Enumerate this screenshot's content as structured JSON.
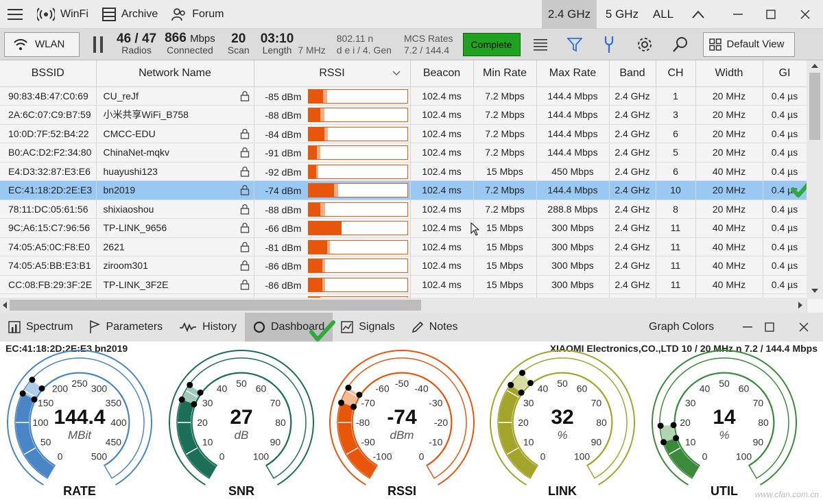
{
  "topbar": {
    "tabs": [
      {
        "label": "WinFi",
        "icon": "wifi-signal-icon"
      },
      {
        "label": "Archive",
        "icon": "archive-icon"
      },
      {
        "label": "Forum",
        "icon": "people-icon"
      }
    ],
    "bands": [
      "2.4 GHz",
      "5 GHz",
      "ALL"
    ],
    "selected_band": "2.4 GHz"
  },
  "toolbar": {
    "wlan_label": "WLAN",
    "radios_value": "46 / 47",
    "radios_label": "Radios",
    "connected_value": "866",
    "connected_unit": "Mbps",
    "connected_label": "Connected",
    "scan_value": "20",
    "scan_label": "Scan",
    "length_value": "03:10",
    "length_label": "Length",
    "freq_partial": "7 MHz",
    "std_line1": "802.11 n",
    "std_line2": "d e i / 4. Gen",
    "mcs_line1": "MCS Rates",
    "mcs_line2": "7.2 / 144.4",
    "complete_label": "Complete",
    "default_view_label": "Default View"
  },
  "table": {
    "columns": [
      "BSSID",
      "Network Name",
      "RSSI",
      "Beacon",
      "Min Rate",
      "Max Rate",
      "Band",
      "CH",
      "Width",
      "GI"
    ],
    "rows": [
      {
        "bssid": "90:83:4B:47:C0:69",
        "name": "CU_reJf",
        "locked": true,
        "rssi": "-85 dBm",
        "rssi_level": 0.15,
        "rssi_peak": 0.19,
        "beacon": "102.4 ms",
        "min": "7.2 Mbps",
        "max": "144.4 Mbps",
        "band": "2.4 GHz",
        "ch": "1",
        "width": "20 MHz",
        "gi": "0.4 µs"
      },
      {
        "bssid": "2A:6C:07:C9:B7:59",
        "name": "小米共享WiFi_B758",
        "locked": false,
        "rssi": "-88 dBm",
        "rssi_level": 0.12,
        "rssi_peak": 0.16,
        "beacon": "102.4 ms",
        "min": "7.2 Mbps",
        "max": "144.4 Mbps",
        "band": "2.4 GHz",
        "ch": "3",
        "width": "20 MHz",
        "gi": "0.4 µs"
      },
      {
        "bssid": "10:0D:7F:52:B4:22",
        "name": "CMCC-EDU",
        "locked": true,
        "rssi": "-84 dBm",
        "rssi_level": 0.16,
        "rssi_peak": 0.2,
        "beacon": "102.4 ms",
        "min": "7.2 Mbps",
        "max": "144.4 Mbps",
        "band": "2.4 GHz",
        "ch": "6",
        "width": "20 MHz",
        "gi": "0.4 µs"
      },
      {
        "bssid": "B0:AC:D2:F2:34:80",
        "name": "ChinaNet-mqkv",
        "locked": true,
        "rssi": "-91 dBm",
        "rssi_level": 0.09,
        "rssi_peak": 0.12,
        "beacon": "102.4 ms",
        "min": "7.2 Mbps",
        "max": "144.4 Mbps",
        "band": "2.4 GHz",
        "ch": "5",
        "width": "20 MHz",
        "gi": "0.4 µs"
      },
      {
        "bssid": "E4:D3:32:87:E3:E6",
        "name": "huayushi123",
        "locked": true,
        "rssi": "-92 dBm",
        "rssi_level": 0.08,
        "rssi_peak": 0.1,
        "beacon": "102.4 ms",
        "min": "15 Mbps",
        "max": "450 Mbps",
        "band": "2.4 GHz",
        "ch": "6",
        "width": "40 MHz",
        "gi": "0.4 µs"
      },
      {
        "bssid": "EC:41:18:2D:2E:E3",
        "name": "bn2019",
        "locked": true,
        "rssi": "-74 dBm",
        "rssi_level": 0.26,
        "rssi_peak": 0.3,
        "beacon": "102.4 ms",
        "min": "7.2 Mbps",
        "max": "144.4 Mbps",
        "band": "2.4 GHz",
        "ch": "10",
        "width": "20 MHz",
        "gi": "0.4 µs",
        "selected": true
      },
      {
        "bssid": "78:11:DC:05:61:56",
        "name": "shixiaoshou",
        "locked": true,
        "rssi": "-88 dBm",
        "rssi_level": 0.12,
        "rssi_peak": 0.17,
        "beacon": "102.4 ms",
        "min": "7.2 Mbps",
        "max": "288.8 Mbps",
        "band": "2.4 GHz",
        "ch": "8",
        "width": "20 MHz",
        "gi": "0.4 µs"
      },
      {
        "bssid": "9C:A6:15:C7:96:56",
        "name": "TP-LINK_9656",
        "locked": true,
        "rssi": "-66 dBm",
        "rssi_level": 0.34,
        "rssi_peak": 0.34,
        "beacon": "102.4 ms",
        "min": "15 Mbps",
        "max": "300 Mbps",
        "band": "2.4 GHz",
        "ch": "11",
        "width": "40 MHz",
        "gi": "0.4 µs"
      },
      {
        "bssid": "74:05:A5:0C:F8:E0",
        "name": "2621",
        "locked": true,
        "rssi": "-81 dBm",
        "rssi_level": 0.19,
        "rssi_peak": 0.22,
        "beacon": "102.4 ms",
        "min": "15 Mbps",
        "max": "300 Mbps",
        "band": "2.4 GHz",
        "ch": "11",
        "width": "40 MHz",
        "gi": "0.4 µs"
      },
      {
        "bssid": "74:05:A5:BB:E3:B1",
        "name": "ziroom301",
        "locked": true,
        "rssi": "-86 dBm",
        "rssi_level": 0.14,
        "rssi_peak": 0.17,
        "beacon": "102.4 ms",
        "min": "15 Mbps",
        "max": "300 Mbps",
        "band": "2.4 GHz",
        "ch": "11",
        "width": "40 MHz",
        "gi": "0.4 µs"
      },
      {
        "bssid": "CC:08:FB:29:3F:2E",
        "name": "TP-LINK_3F2E",
        "locked": true,
        "rssi": "-86 dBm",
        "rssi_level": 0.14,
        "rssi_peak": 0.17,
        "beacon": "102.4 ms",
        "min": "15 Mbps",
        "max": "300 Mbps",
        "band": "2.4 GHz",
        "ch": "11",
        "width": "40 MHz",
        "gi": "0.4 µs"
      }
    ]
  },
  "bottom_tabs": [
    {
      "label": "Spectrum",
      "icon": "spectrum-icon"
    },
    {
      "label": "Parameters",
      "icon": "flag-icon"
    },
    {
      "label": "History",
      "icon": "history-wave-icon"
    },
    {
      "label": "Dashboard",
      "icon": "dashboard-circle-icon",
      "selected": true
    },
    {
      "label": "Signals",
      "icon": "signals-icon"
    },
    {
      "label": "Notes",
      "icon": "pen-icon"
    }
  ],
  "graph_colors_label": "Graph Colors",
  "dashboard": {
    "left_header": "EC:41:18:2D:2E:E3   bn2019",
    "right_header": "XIAOMI Electronics,CO.,LTD    10  /  20 MHz    n  7.2 / 144.4 Mbps",
    "watermark": "www.cfan.com.cn",
    "gauges": [
      {
        "name": "RATE",
        "value": "144.4",
        "unit": "MBit",
        "color": "#4a86c5",
        "light": "#aecbe8",
        "ticks": [
          "0",
          "50",
          "100",
          "150",
          "200",
          "250",
          "300",
          "350",
          "400",
          "450",
          "500"
        ],
        "level": 0.29
      },
      {
        "name": "SNR",
        "value": "27",
        "unit": "dB",
        "color": "#1b6e57",
        "light": "#9fc9bb",
        "ticks": [
          "0",
          "10",
          "20",
          "30",
          "40",
          "50",
          "60",
          "70",
          "80",
          "90",
          "100"
        ],
        "level": 0.27
      },
      {
        "name": "RSSI",
        "value": "-74",
        "unit": "dBm",
        "color": "#e8560c",
        "light": "#f4b996",
        "ticks": [
          "-100",
          "-90",
          "-80",
          "-70",
          "-60",
          "-50",
          "-40",
          "-30",
          "-20",
          "-10",
          "0"
        ],
        "level": 0.26
      },
      {
        "name": "LINK",
        "value": "32",
        "unit": "%",
        "color": "#a3a52a",
        "light": "#d9dba5",
        "ticks": [
          "0",
          "10",
          "20",
          "30",
          "40",
          "50",
          "60",
          "70",
          "80",
          "90",
          "100"
        ],
        "level": 0.32
      },
      {
        "name": "UTIL",
        "value": "14",
        "unit": "%",
        "color": "#3a8a3a",
        "light": "#b3d4b3",
        "ticks": [
          "0",
          "10",
          "20",
          "30",
          "40",
          "50",
          "60",
          "70",
          "80",
          "90",
          "100"
        ],
        "level": 0.14
      }
    ]
  }
}
